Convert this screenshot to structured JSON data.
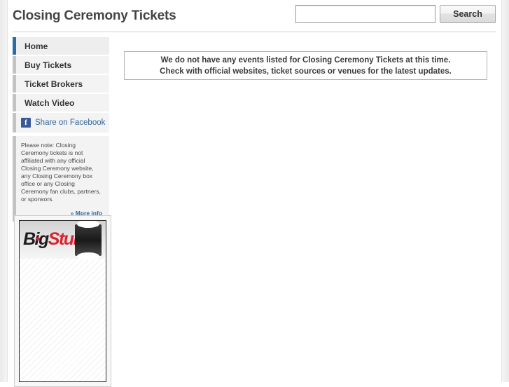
{
  "header": {
    "site_title": "Closing Ceremony Tickets",
    "search": {
      "value": "",
      "placeholder": "",
      "button_label": "Search"
    }
  },
  "sidebar": {
    "nav_items": [
      {
        "label": "Home",
        "active": true
      },
      {
        "label": "Buy Tickets",
        "active": false
      },
      {
        "label": "Ticket Brokers",
        "active": false
      },
      {
        "label": "Watch Video",
        "active": false
      }
    ],
    "facebook": {
      "icon_glyph": "f",
      "label": "Share on Facebook"
    },
    "disclaimer": {
      "text": "Please note: Closing Ceremony tickets is not affiliated with any official Closing Ceremony website, any Closing Ceremony box office or any Closing Ceremony fan clubs, partners, or sponsors.",
      "more_link": "» More info"
    },
    "ad": {
      "logo_first": "Big",
      "logo_second": "Stub"
    }
  },
  "main": {
    "notice": {
      "line1": "We do not have any events listed for Closing Ceremony Tickets at this time.",
      "line2": "Check with official websites, ticket sources or venues for the latest updates."
    }
  },
  "colors": {
    "accent_blue": "#2b6ca3",
    "link_blue": "#31659c",
    "facebook_blue": "#3b5998",
    "logo_red": "#d9232e",
    "nav_bar_gray": "#c3c3c3"
  }
}
